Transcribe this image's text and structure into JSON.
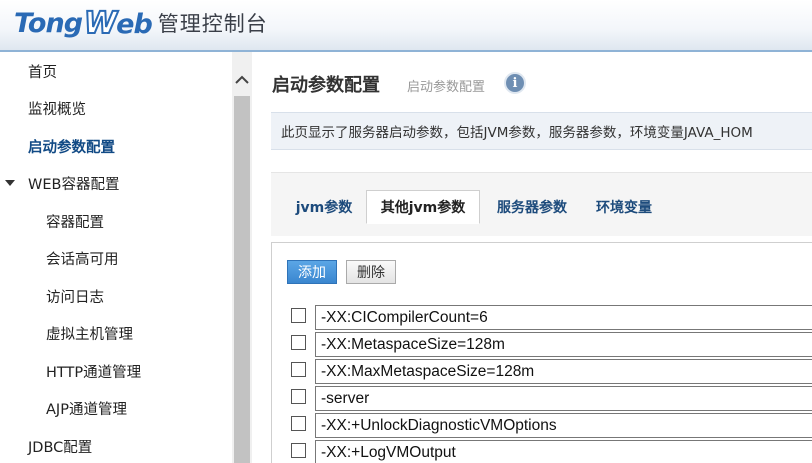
{
  "header": {
    "logo_tong": "Tong",
    "logo_w": "W",
    "logo_eb": "eb",
    "title_cn": "管理控制台"
  },
  "sidebar": {
    "items": [
      {
        "label": "首页"
      },
      {
        "label": "监视概览"
      },
      {
        "label": "启动参数配置"
      },
      {
        "label": "WEB容器配置"
      },
      {
        "label": "容器配置"
      },
      {
        "label": "会话高可用"
      },
      {
        "label": "访问日志"
      },
      {
        "label": "虚拟主机管理"
      },
      {
        "label": "HTTP通道管理"
      },
      {
        "label": "AJP通道管理"
      },
      {
        "label": "JDBC配置"
      }
    ],
    "scroll_up_icon": "chevron-up-icon"
  },
  "main": {
    "title": "启动参数配置",
    "subtitle": "启动参数配置",
    "info_icon": "i",
    "description": "此页显示了服务器启动参数，包括JVM参数，服务器参数，环境变量JAVA_HOM",
    "tabs": [
      {
        "label": "jvm参数"
      },
      {
        "label": "其他jvm参数"
      },
      {
        "label": "服务器参数"
      },
      {
        "label": "环境变量"
      }
    ],
    "active_tab": "其他jvm参数",
    "add_label": "添加",
    "delete_label": "删除",
    "params": [
      {
        "value": "-XX:CICompilerCount=6"
      },
      {
        "value": "-XX:MetaspaceSize=128m"
      },
      {
        "value": "-XX:MaxMetaspaceSize=128m"
      },
      {
        "value": "-server"
      },
      {
        "value": "-XX:+UnlockDiagnosticVMOptions"
      },
      {
        "value": "-XX:+LogVMOutput"
      }
    ]
  },
  "colors": {
    "accent": "#2a6ab5",
    "active_nav": "#114a85",
    "add_button": "#3a86cf"
  }
}
